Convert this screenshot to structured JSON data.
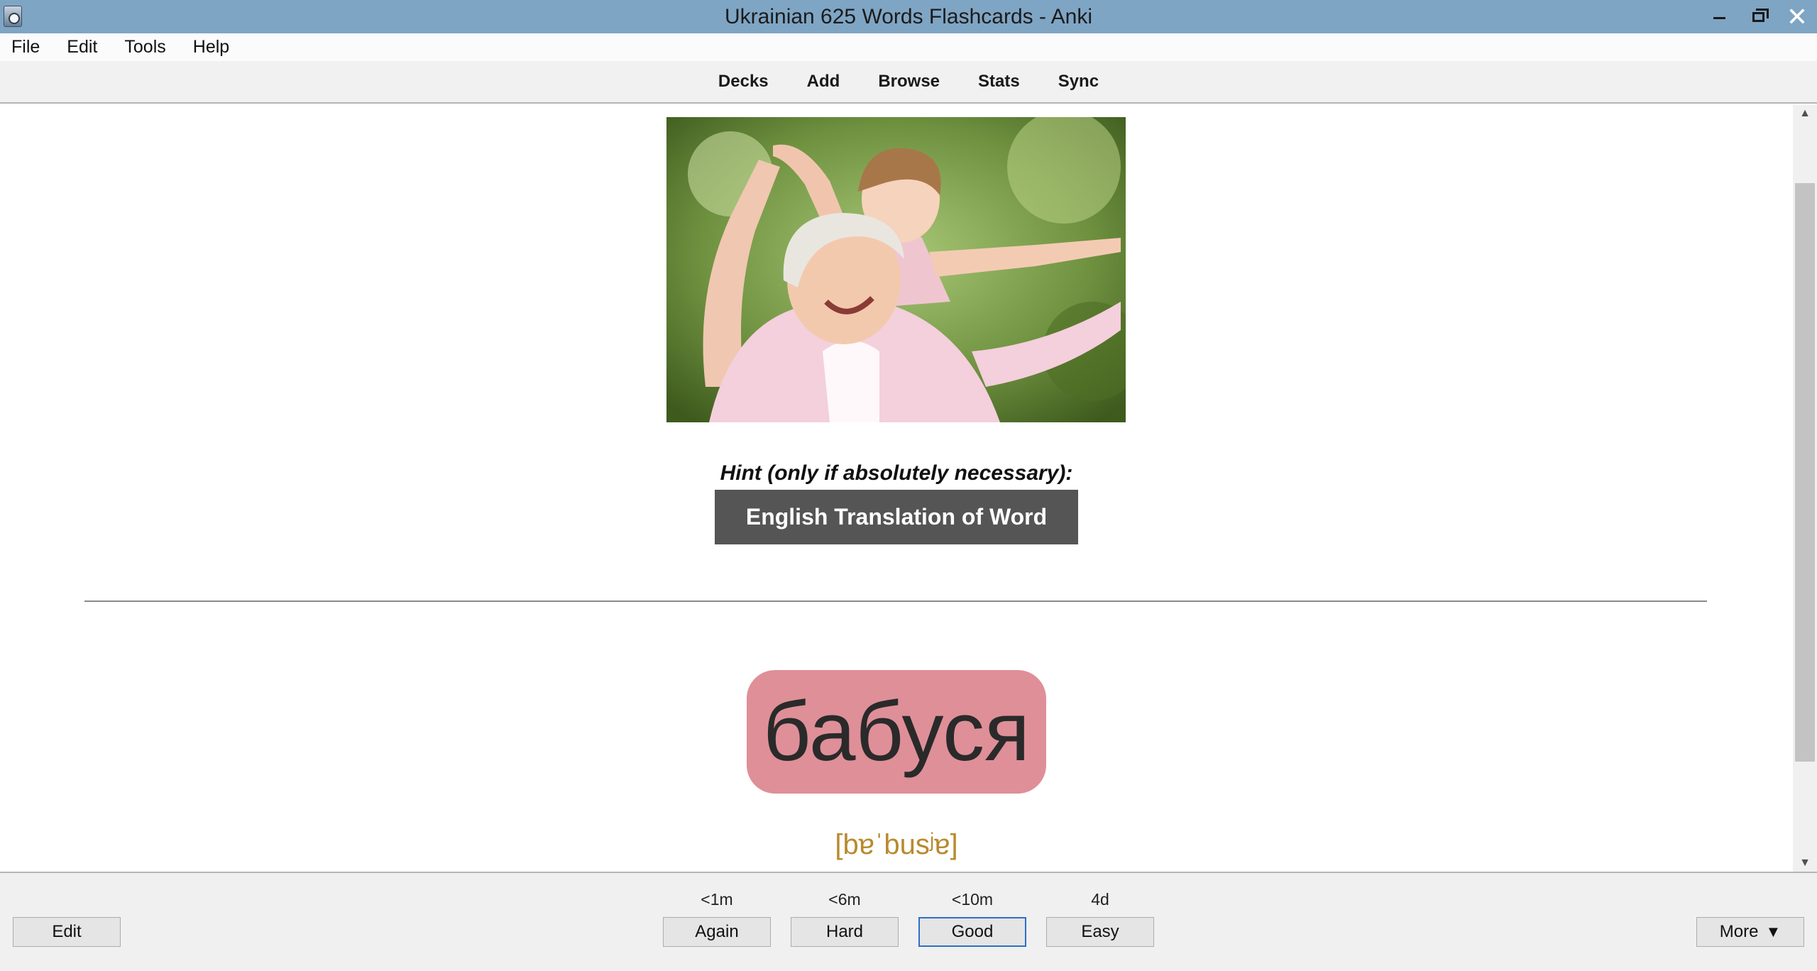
{
  "window": {
    "title": "Ukrainian 625 Words Flashcards - Anki",
    "close_glyph": "✕"
  },
  "menu": {
    "items": [
      "File",
      "Edit",
      "Tools",
      "Help"
    ]
  },
  "toolbar": {
    "links": [
      "Decks",
      "Add",
      "Browse",
      "Stats",
      "Sync"
    ]
  },
  "card": {
    "image_icon": "photo-grandmother-granddaughter",
    "hint_label": "Hint (only if absolutely necessary):",
    "hint_button_label": "English Translation of Word",
    "word": "бабуся",
    "word_bg_color": "#df8f98",
    "pronunciation": "[bɐˈbusʲɐ]",
    "pronunciation_color": "#b88a2e"
  },
  "scrollbar": {
    "up_glyph": "▲",
    "down_glyph": "▼"
  },
  "bottom": {
    "edit_label": "Edit",
    "answers": [
      {
        "label": "Again",
        "interval": "<1m"
      },
      {
        "label": "Hard",
        "interval": "<6m"
      },
      {
        "label": "Good",
        "interval": "<10m"
      },
      {
        "label": "Easy",
        "interval": "4d"
      }
    ],
    "more_label": "More",
    "more_arrow": "▼"
  }
}
